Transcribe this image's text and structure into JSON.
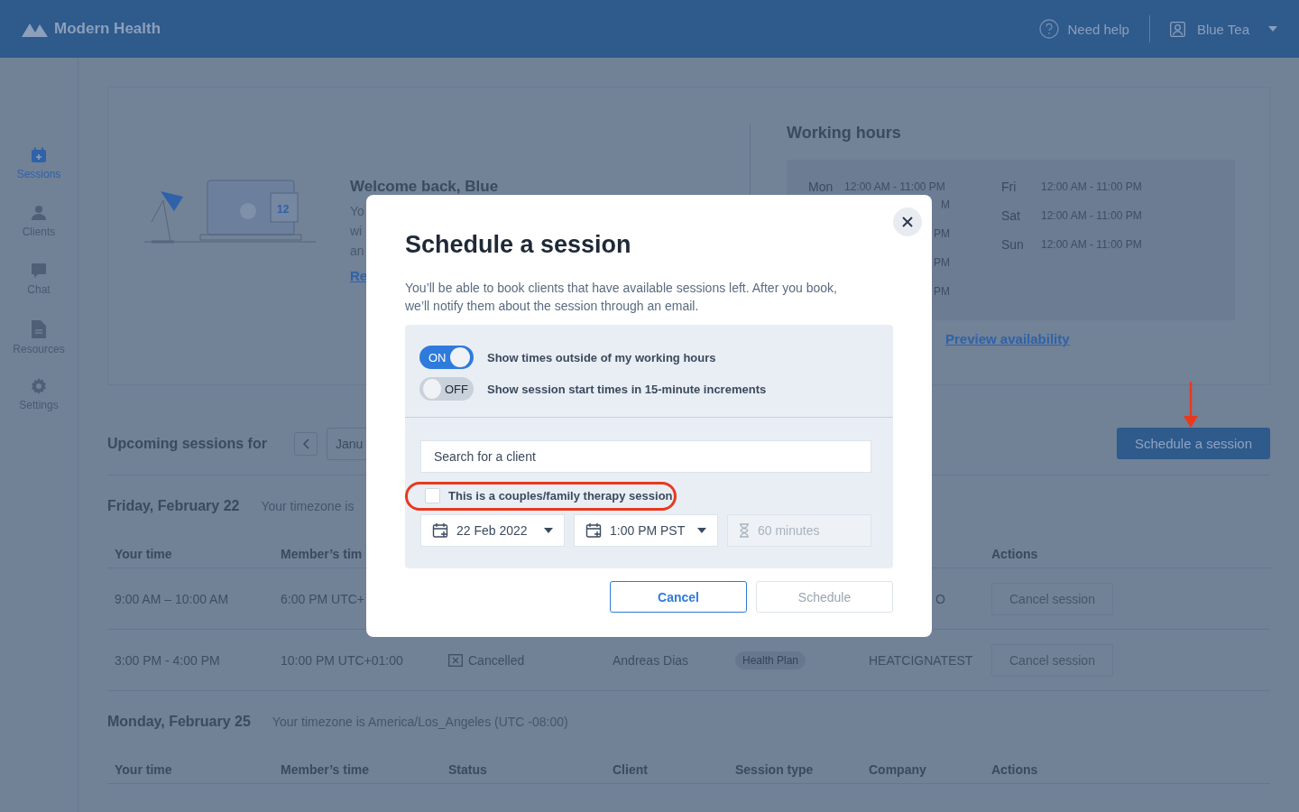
{
  "header": {
    "brand": "Modern Health",
    "help": "Need help",
    "user": "Blue Tea"
  },
  "sidebar": {
    "items": [
      {
        "label": "Sessions",
        "selected": true
      },
      {
        "label": "Clients",
        "selected": false
      },
      {
        "label": "Chat",
        "selected": false
      },
      {
        "label": "Resources",
        "selected": false
      },
      {
        "label": "Settings",
        "selected": false
      }
    ]
  },
  "welcome": {
    "title": "Welcome back, Blue",
    "text_lines": [
      "Yo",
      "wi",
      "an"
    ],
    "link": "Re",
    "illustration_date": "12"
  },
  "working_hours": {
    "title": "Working hours",
    "left": [
      {
        "day": "Mon",
        "hours": "12:00 AM - 11:00 PM"
      }
    ],
    "left_fragments": [
      "M",
      "PM",
      "PM",
      "PM"
    ],
    "right": [
      {
        "day": "Fri",
        "hours": "12:00 AM - 11:00 PM"
      },
      {
        "day": "Sat",
        "hours": "12:00 AM - 11:00 PM"
      },
      {
        "day": "Sun",
        "hours": "12:00 AM - 11:00 PM"
      }
    ],
    "link": "Preview availability"
  },
  "upcoming": {
    "title": "Upcoming sessions for",
    "month": "Janu",
    "schedule_button": "Schedule a session"
  },
  "days": [
    {
      "title": "Friday, February 22",
      "timezone": "Your timezone is",
      "columns": {
        "your_time": "Your time",
        "member_time": "Member’s tim",
        "actions": "Actions"
      },
      "rows": [
        {
          "your_time": "9:00 AM – 10:00 AM",
          "member_time": "6:00 PM UTC+",
          "company_fragment": "O",
          "action": "Cancel session"
        },
        {
          "your_time": "3:00 PM - 4:00 PM",
          "member_time": "10:00 PM UTC+01:00",
          "status": "Cancelled",
          "client": "Andreas Dias",
          "session_type": "Health Plan",
          "company": "HEATCIGNATEST",
          "action": "Cancel session"
        }
      ]
    },
    {
      "title": "Monday, February 25",
      "timezone": "Your timezone is America/Los_Angeles (UTC -08:00)",
      "columns": {
        "your_time": "Your time",
        "member_time": "Member’s time",
        "status": "Status",
        "client": "Client",
        "session_type": "Session type",
        "company": "Company",
        "actions": "Actions"
      }
    }
  ],
  "modal": {
    "title": "Schedule a session",
    "description": "You’ll be able to book clients that have available sessions left. After you book, we’ll notify them about the session through an email.",
    "toggles": [
      {
        "state_label": "ON",
        "on": true,
        "label": "Show times outside of my working hours"
      },
      {
        "state_label": "OFF",
        "on": false,
        "label": "Show session start times in 15-minute increments"
      }
    ],
    "search": {
      "placeholder": "Search for a client"
    },
    "checkbox": {
      "label": "This is a couples/family therapy session",
      "checked": false
    },
    "date": "22 Feb 2022",
    "time": "1:00 PM PST",
    "duration": {
      "placeholder": "60 minutes",
      "disabled": true
    },
    "cancel_button": "Cancel",
    "schedule_button": {
      "label": "Schedule",
      "disabled": true
    }
  }
}
